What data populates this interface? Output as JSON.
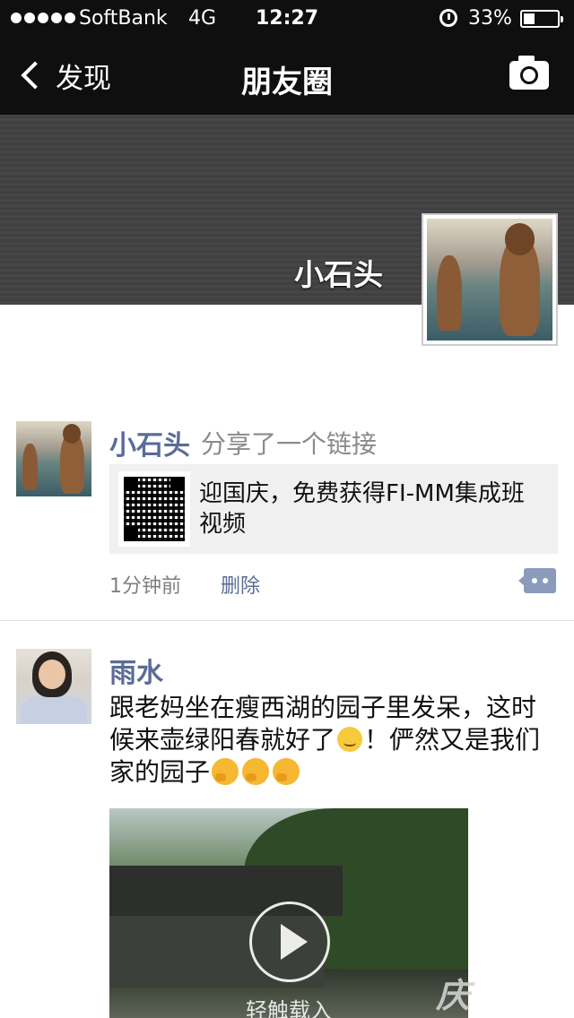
{
  "status_bar": {
    "carrier": "SoftBank",
    "network": "4G",
    "time": "12:27",
    "battery_percent": "33%",
    "icons": [
      "signal-dots-icon",
      "alarm-icon",
      "battery-icon"
    ]
  },
  "nav": {
    "back_label": "发现",
    "title": "朋友圈",
    "back_icon": "chevron-left-icon",
    "camera_icon": "camera-icon"
  },
  "profile": {
    "name": "小石头"
  },
  "posts": [
    {
      "author": "小石头",
      "action": "分享了一个链接",
      "link_title": "迎国庆，免费获得FI-MM集成班视频",
      "time": "1分钟前",
      "delete_label": "删除"
    },
    {
      "author": "雨水",
      "text_part1": "跟老妈坐在瘦西湖的园子里发呆，这时候来壶绿阳春就好了",
      "text_part2": "！俨然又是我们家的园子",
      "video_hint": "轻触载入"
    }
  ],
  "watermark": "庆"
}
